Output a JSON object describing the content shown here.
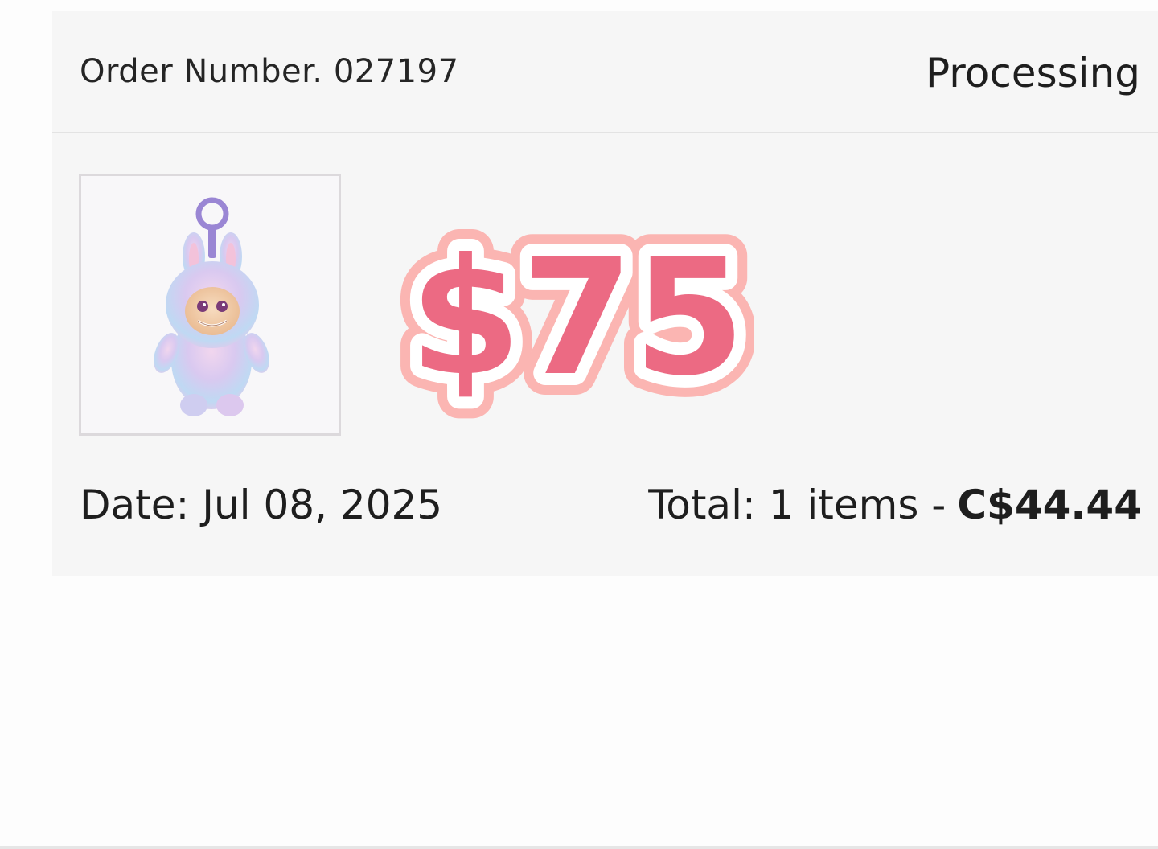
{
  "order": {
    "number_label": "Order Number. 027197",
    "status": "Processing",
    "date_label": "Date: Jul 08, 2025",
    "total_label": "Total: 1 items -",
    "total_amount": "C$44.44"
  },
  "sticker": {
    "text": "$75",
    "fill_color": "#ec6a83",
    "inner_outline_color": "#ffffff",
    "outer_outline_color": "#fbb5b2"
  },
  "product": {
    "image_icon": "plush-bunny-keychain"
  },
  "colors": {
    "card_background": "#f6f6f6",
    "divider": "#e3e3e3",
    "text": "#1e1e1e"
  }
}
